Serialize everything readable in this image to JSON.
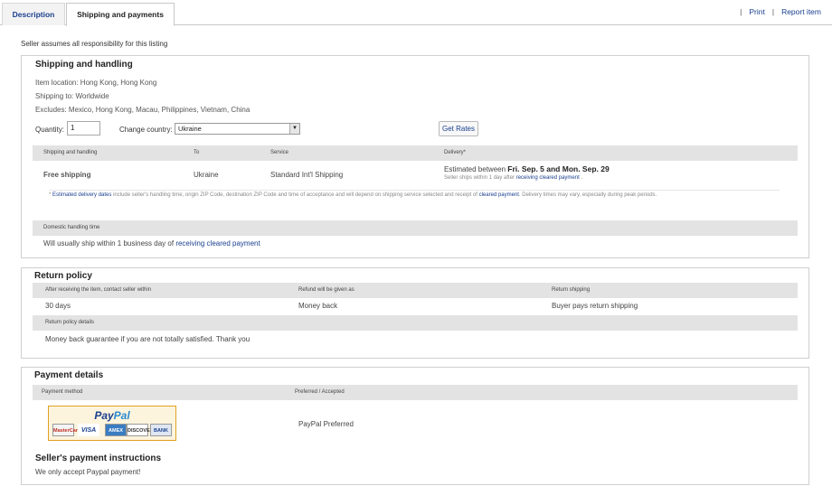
{
  "tabs": {
    "description": "Description",
    "shipping": "Shipping and payments"
  },
  "top_links": {
    "sep": "|",
    "print": "Print",
    "report": "Report item"
  },
  "disclaimer": "Seller assumes all responsibility for this listing",
  "shipping": {
    "title": "Shipping and handling",
    "location": "Item location: Hong Kong, Hong Kong",
    "ships_to": "Shipping to: Worldwide",
    "excludes": "Excludes: Mexico, Hong Kong, Macau, Philippines, Vietnam, China",
    "qty_label": "Quantity:",
    "qty_value": "1",
    "country_label": "Change country:",
    "country_value": "Ukraine",
    "get_rates": "Get Rates",
    "table_headers": [
      "Shipping and handling",
      "To",
      "Service",
      "Delivery*"
    ],
    "row": {
      "cost": "Free shipping",
      "to": "Ukraine",
      "service": "Standard Int'l Shipping",
      "est_prefix": "Estimated between",
      "est_dates": "Fri. Sep. 5 and Mon. Sep. 29",
      "sub_prefix": "Seller ships within 1 day after",
      "sub_link": "receiving cleared payment",
      "sub_suffix": "."
    },
    "note_star": "*",
    "note_link": "Estimated delivery dates",
    "note_mid": "include seller's handling time, origin ZIP Code, destination ZIP Code and time of acceptance and will depend on shipping service selected and receipt of",
    "note_link2": "cleared payment",
    "note_end": ". Delivery times may vary, especially during peak periods.",
    "domestic_header": "Domestic handling time",
    "domestic_text": "Will usually ship within 1 business day of",
    "domestic_link": "receiving cleared payment"
  },
  "returns": {
    "title": "Return policy",
    "headers": [
      "After receiving the item, contact seller within",
      "Refund will be given as",
      "Return shipping"
    ],
    "values": [
      "30 days",
      "Money back",
      "Buyer pays return shipping"
    ],
    "details_header": "Return policy details",
    "details_text": "Money back guarantee if you are not totally satisfied. Thank you"
  },
  "payment": {
    "title": "Payment details",
    "headers": [
      "Payment method",
      "Preferred / Accepted"
    ],
    "logo_text_pay": "Pay",
    "logo_text_pal": "Pal",
    "cards": [
      "MasterCard",
      "VISA",
      "AMEX",
      "DISCOVER",
      "BANK"
    ],
    "preferred": "PayPal Preferred",
    "instructions_title": "Seller's payment instructions",
    "instructions_text": "We only accept Paypal payment!"
  }
}
